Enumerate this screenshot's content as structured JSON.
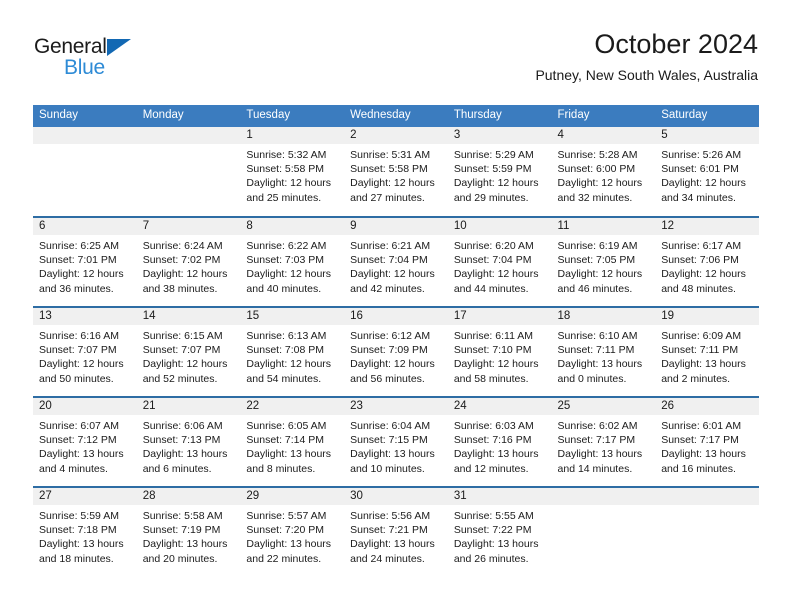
{
  "brand": {
    "line1": "General",
    "line2": "Blue",
    "triangle_color": "#1268b3",
    "blue_text_color": "#2e8bd6",
    "icon": "triangle-logo-icon"
  },
  "header": {
    "title": "October 2024",
    "subtitle": "Putney, New South Wales, Australia"
  },
  "theme": {
    "header_blue": "#3b7cbf",
    "row_divider_blue": "#2e6da4",
    "daynum_strip_gray": "#f0f0f0",
    "text_color": "#1b1b1b"
  },
  "weekday_headers": [
    "Sunday",
    "Monday",
    "Tuesday",
    "Wednesday",
    "Thursday",
    "Friday",
    "Saturday"
  ],
  "weeks": [
    [
      {
        "day": "",
        "lines": []
      },
      {
        "day": "",
        "lines": []
      },
      {
        "day": "1",
        "lines": [
          "Sunrise: 5:32 AM",
          "Sunset: 5:58 PM",
          "Daylight: 12 hours",
          "and 25 minutes."
        ]
      },
      {
        "day": "2",
        "lines": [
          "Sunrise: 5:31 AM",
          "Sunset: 5:58 PM",
          "Daylight: 12 hours",
          "and 27 minutes."
        ]
      },
      {
        "day": "3",
        "lines": [
          "Sunrise: 5:29 AM",
          "Sunset: 5:59 PM",
          "Daylight: 12 hours",
          "and 29 minutes."
        ]
      },
      {
        "day": "4",
        "lines": [
          "Sunrise: 5:28 AM",
          "Sunset: 6:00 PM",
          "Daylight: 12 hours",
          "and 32 minutes."
        ]
      },
      {
        "day": "5",
        "lines": [
          "Sunrise: 5:26 AM",
          "Sunset: 6:01 PM",
          "Daylight: 12 hours",
          "and 34 minutes."
        ]
      }
    ],
    [
      {
        "day": "6",
        "lines": [
          "Sunrise: 6:25 AM",
          "Sunset: 7:01 PM",
          "Daylight: 12 hours",
          "and 36 minutes."
        ]
      },
      {
        "day": "7",
        "lines": [
          "Sunrise: 6:24 AM",
          "Sunset: 7:02 PM",
          "Daylight: 12 hours",
          "and 38 minutes."
        ]
      },
      {
        "day": "8",
        "lines": [
          "Sunrise: 6:22 AM",
          "Sunset: 7:03 PM",
          "Daylight: 12 hours",
          "and 40 minutes."
        ]
      },
      {
        "day": "9",
        "lines": [
          "Sunrise: 6:21 AM",
          "Sunset: 7:04 PM",
          "Daylight: 12 hours",
          "and 42 minutes."
        ]
      },
      {
        "day": "10",
        "lines": [
          "Sunrise: 6:20 AM",
          "Sunset: 7:04 PM",
          "Daylight: 12 hours",
          "and 44 minutes."
        ]
      },
      {
        "day": "11",
        "lines": [
          "Sunrise: 6:19 AM",
          "Sunset: 7:05 PM",
          "Daylight: 12 hours",
          "and 46 minutes."
        ]
      },
      {
        "day": "12",
        "lines": [
          "Sunrise: 6:17 AM",
          "Sunset: 7:06 PM",
          "Daylight: 12 hours",
          "and 48 minutes."
        ]
      }
    ],
    [
      {
        "day": "13",
        "lines": [
          "Sunrise: 6:16 AM",
          "Sunset: 7:07 PM",
          "Daylight: 12 hours",
          "and 50 minutes."
        ]
      },
      {
        "day": "14",
        "lines": [
          "Sunrise: 6:15 AM",
          "Sunset: 7:07 PM",
          "Daylight: 12 hours",
          "and 52 minutes."
        ]
      },
      {
        "day": "15",
        "lines": [
          "Sunrise: 6:13 AM",
          "Sunset: 7:08 PM",
          "Daylight: 12 hours",
          "and 54 minutes."
        ]
      },
      {
        "day": "16",
        "lines": [
          "Sunrise: 6:12 AM",
          "Sunset: 7:09 PM",
          "Daylight: 12 hours",
          "and 56 minutes."
        ]
      },
      {
        "day": "17",
        "lines": [
          "Sunrise: 6:11 AM",
          "Sunset: 7:10 PM",
          "Daylight: 12 hours",
          "and 58 minutes."
        ]
      },
      {
        "day": "18",
        "lines": [
          "Sunrise: 6:10 AM",
          "Sunset: 7:11 PM",
          "Daylight: 13 hours",
          "and 0 minutes."
        ]
      },
      {
        "day": "19",
        "lines": [
          "Sunrise: 6:09 AM",
          "Sunset: 7:11 PM",
          "Daylight: 13 hours",
          "and 2 minutes."
        ]
      }
    ],
    [
      {
        "day": "20",
        "lines": [
          "Sunrise: 6:07 AM",
          "Sunset: 7:12 PM",
          "Daylight: 13 hours",
          "and 4 minutes."
        ]
      },
      {
        "day": "21",
        "lines": [
          "Sunrise: 6:06 AM",
          "Sunset: 7:13 PM",
          "Daylight: 13 hours",
          "and 6 minutes."
        ]
      },
      {
        "day": "22",
        "lines": [
          "Sunrise: 6:05 AM",
          "Sunset: 7:14 PM",
          "Daylight: 13 hours",
          "and 8 minutes."
        ]
      },
      {
        "day": "23",
        "lines": [
          "Sunrise: 6:04 AM",
          "Sunset: 7:15 PM",
          "Daylight: 13 hours",
          "and 10 minutes."
        ]
      },
      {
        "day": "24",
        "lines": [
          "Sunrise: 6:03 AM",
          "Sunset: 7:16 PM",
          "Daylight: 13 hours",
          "and 12 minutes."
        ]
      },
      {
        "day": "25",
        "lines": [
          "Sunrise: 6:02 AM",
          "Sunset: 7:17 PM",
          "Daylight: 13 hours",
          "and 14 minutes."
        ]
      },
      {
        "day": "26",
        "lines": [
          "Sunrise: 6:01 AM",
          "Sunset: 7:17 PM",
          "Daylight: 13 hours",
          "and 16 minutes."
        ]
      }
    ],
    [
      {
        "day": "27",
        "lines": [
          "Sunrise: 5:59 AM",
          "Sunset: 7:18 PM",
          "Daylight: 13 hours",
          "and 18 minutes."
        ]
      },
      {
        "day": "28",
        "lines": [
          "Sunrise: 5:58 AM",
          "Sunset: 7:19 PM",
          "Daylight: 13 hours",
          "and 20 minutes."
        ]
      },
      {
        "day": "29",
        "lines": [
          "Sunrise: 5:57 AM",
          "Sunset: 7:20 PM",
          "Daylight: 13 hours",
          "and 22 minutes."
        ]
      },
      {
        "day": "30",
        "lines": [
          "Sunrise: 5:56 AM",
          "Sunset: 7:21 PM",
          "Daylight: 13 hours",
          "and 24 minutes."
        ]
      },
      {
        "day": "31",
        "lines": [
          "Sunrise: 5:55 AM",
          "Sunset: 7:22 PM",
          "Daylight: 13 hours",
          "and 26 minutes."
        ]
      },
      {
        "day": "",
        "lines": []
      },
      {
        "day": "",
        "lines": []
      }
    ]
  ]
}
